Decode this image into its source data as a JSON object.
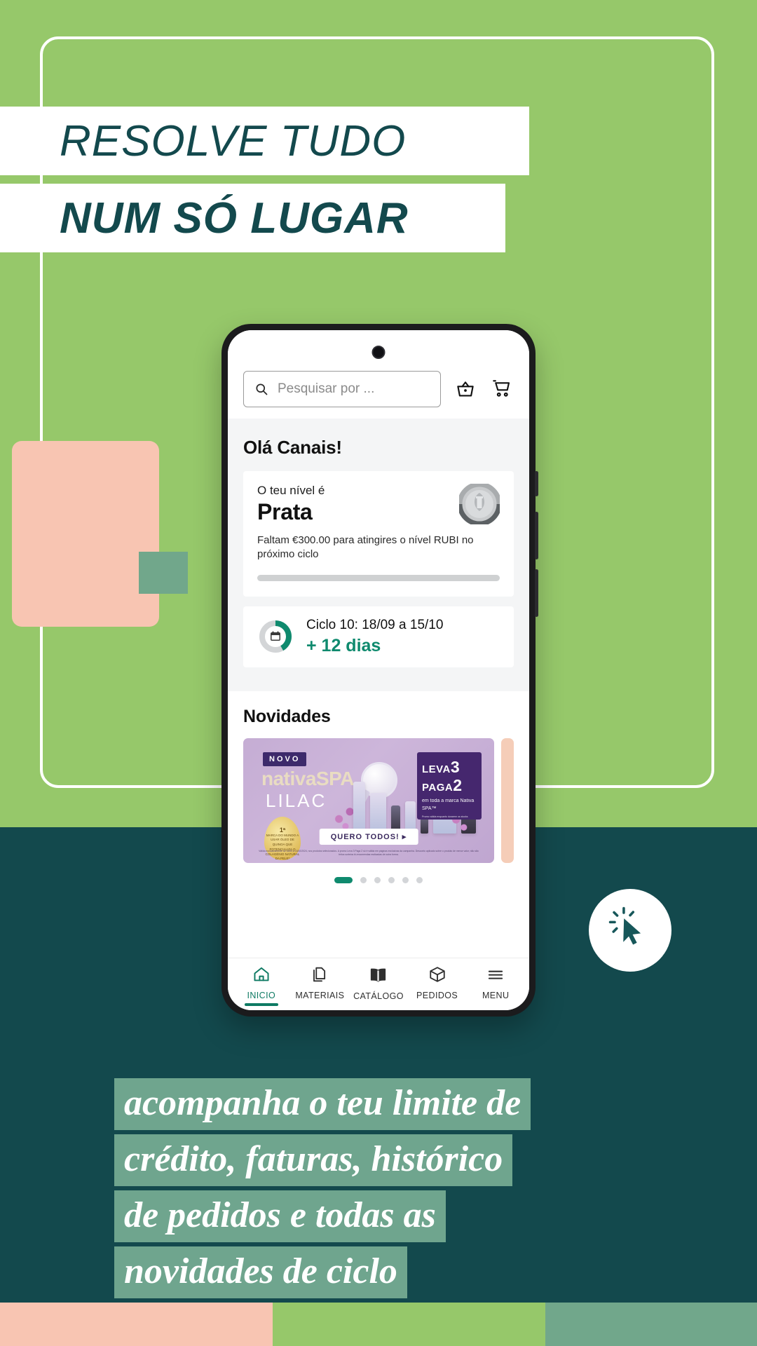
{
  "poster": {
    "headline_line1": "RESOLVE TUDO",
    "headline_line2": "NUM SÓ LUGAR",
    "quote_lines": [
      "acompanha o teu limite de",
      "crédito, faturas, histórico",
      "de pedidos e todas as",
      "novidades de ciclo"
    ],
    "colors": {
      "green": "#96c86a",
      "teal": "#13494d",
      "peach": "#f8c5b2",
      "sage": "#71a78b",
      "accent_teal": "#0f8a6e"
    },
    "strip": [
      "#f8c5b2",
      "#96c86a",
      "#71a78b"
    ],
    "click_badge_icon": "cursor-click-icon"
  },
  "app": {
    "search": {
      "placeholder": "Pesquisar por ...",
      "icon": "search-icon"
    },
    "header_icons": [
      {
        "name": "basket-icon",
        "label": "Cesto"
      },
      {
        "name": "cart-icon",
        "label": "Carrinho"
      }
    ],
    "greeting": "Olá Canais!",
    "level_card": {
      "subtitle": "O teu nível é",
      "level": "Prata",
      "description": "Faltam €300.00 para atingires o nível RUBI no próximo ciclo",
      "medal_icon": "silver-medal-icon",
      "progress_percent": 0
    },
    "cycle_card": {
      "icon": "calendar-icon",
      "title": "Ciclo 10: 18/09 a 15/10",
      "days_left": "+ 12 dias",
      "donut_percent": 42
    },
    "news": {
      "section_title": "Novidades",
      "banner": {
        "tag": "NOVO",
        "brand": "nativaSPA",
        "line": "LILAC",
        "promo_title_1": "LEVA",
        "promo_num_1": "3",
        "promo_title_2": "PAGA",
        "promo_num_2": "2",
        "promo_sub": "em toda a marca Nativa SPA™",
        "promo_fine": "Promo válida enquanto durarem os stocks",
        "badge_rank": "1ª",
        "badge_text": "MARCA DO MUNDO A USAR ÓLEO DE QUINOA QUE POTENCIALIZA O COLAGÉNIO NATURAL DA PELE*",
        "cta": "QUERO TODOS! ▸",
        "legal": "Válido exclusivamente de 16/09 a 15/10/2024, nos produtos selecionados. A promo Leva 3 Paga 2 só é válida em páginas exclusivas da campanha. Desconto aplicado sobre o produto de menor valor; não são feitos sorteios bi-encomendas realizadas de outra forma."
      },
      "dots_total": 6,
      "dots_active": 1
    },
    "nav": [
      {
        "label": "INICIO",
        "icon": "home-icon",
        "active": true
      },
      {
        "label": "MATERIAIS",
        "icon": "documents-icon",
        "active": false
      },
      {
        "label": "CATÁLOGO",
        "icon": "book-icon",
        "active": false
      },
      {
        "label": "PEDIDOS",
        "icon": "package-icon",
        "active": false
      },
      {
        "label": "MENU",
        "icon": "hamburger-icon",
        "active": false
      }
    ]
  }
}
